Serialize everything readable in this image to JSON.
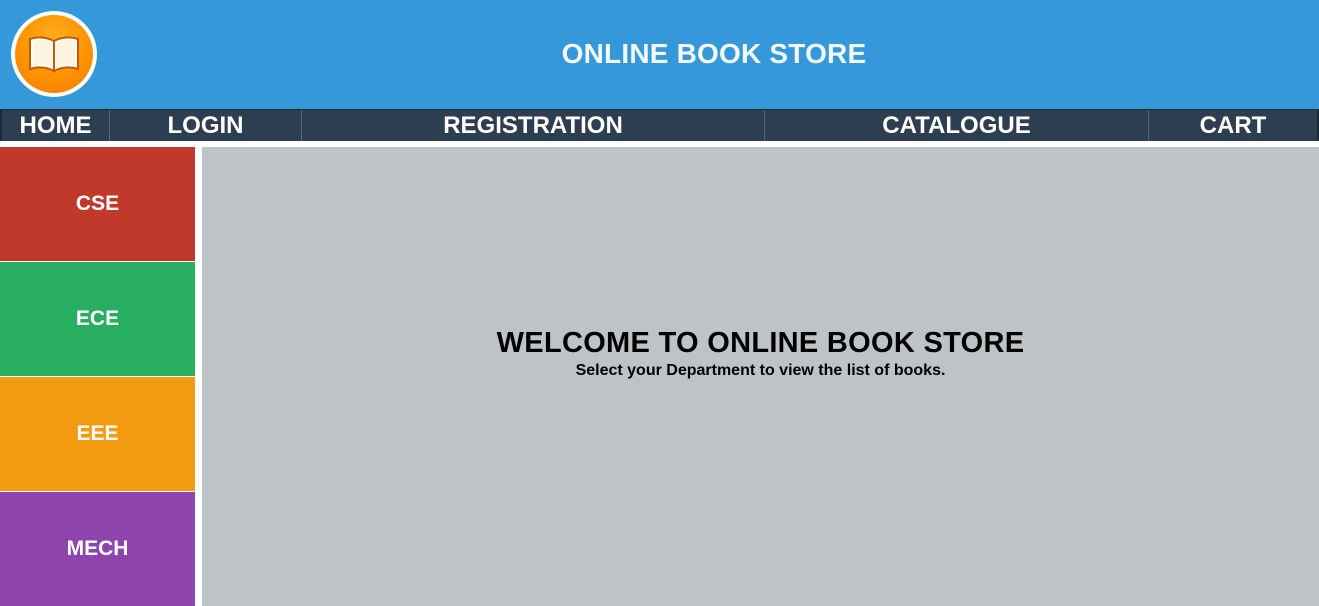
{
  "header": {
    "logo_icon": "open-book-icon",
    "title": "ONLINE BOOK STORE"
  },
  "nav": {
    "items": [
      {
        "label": "HOME"
      },
      {
        "label": "LOGIN"
      },
      {
        "label": "REGISTRATION"
      },
      {
        "label": "CATALOGUE"
      },
      {
        "label": "CART"
      }
    ]
  },
  "sidebar": {
    "departments": [
      {
        "label": "CSE",
        "color": "#c0392b"
      },
      {
        "label": "ECE",
        "color": "#27ae60"
      },
      {
        "label": "EEE",
        "color": "#f39c12"
      },
      {
        "label": "MECH",
        "color": "#8e44ad"
      }
    ]
  },
  "main": {
    "heading": "WELCOME TO ONLINE BOOK STORE",
    "subtext": "Select your Department to view the list of books."
  },
  "colors": {
    "header_bg": "#3498db",
    "nav_bg": "#2c3e50",
    "main_bg": "#bdc3c7"
  }
}
